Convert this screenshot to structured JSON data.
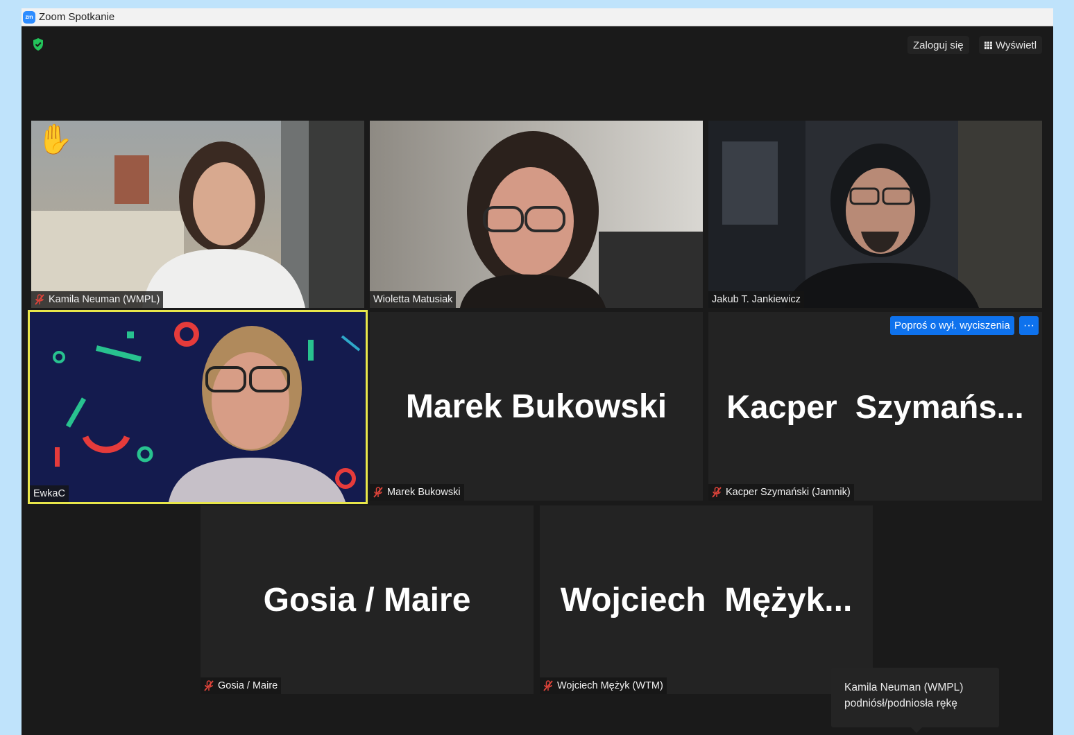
{
  "window": {
    "title": "Zoom Spotkanie",
    "logo_text": "zm"
  },
  "toolbar": {
    "sign_in_label": "Zaloguj się",
    "view_label": "Wyświetl"
  },
  "tiles": {
    "kamila": {
      "name": "Kamila Neuman (WMPL)",
      "muted": true,
      "hand_raised": true
    },
    "wioletta": {
      "name": "Wioletta Matusiak",
      "muted": false
    },
    "jakub": {
      "name": "Jakub T. Jankiewicz",
      "muted": false
    },
    "ewka": {
      "name": "EwkaC",
      "muted": false,
      "active_speaker": true
    },
    "marek": {
      "display": "Marek Bukowski",
      "name": "Marek Bukowski",
      "muted": true
    },
    "kacper": {
      "display": "Kacper  Szymańs...",
      "name": "Kacper Szymański (Jamnik)",
      "muted": true,
      "ask_unmute_label": "Poproś o wył. wyciszenia",
      "more_label": "···"
    },
    "gosia": {
      "display": "Gosia / Maire",
      "name": "Gosia / Maire",
      "muted": true
    },
    "wojciech": {
      "display": "Wojciech  Mężyk...",
      "name": "Wojciech Mężyk (WTM)",
      "muted": true
    }
  },
  "notification": {
    "line1": "Kamila Neuman (WMPL)",
    "line2": "podniósł/podniosła rękę"
  },
  "colors": {
    "accent": "#0e72ed",
    "active_border": "#e8e64a",
    "muted_icon": "#e0443a",
    "secure": "#23c35a"
  }
}
